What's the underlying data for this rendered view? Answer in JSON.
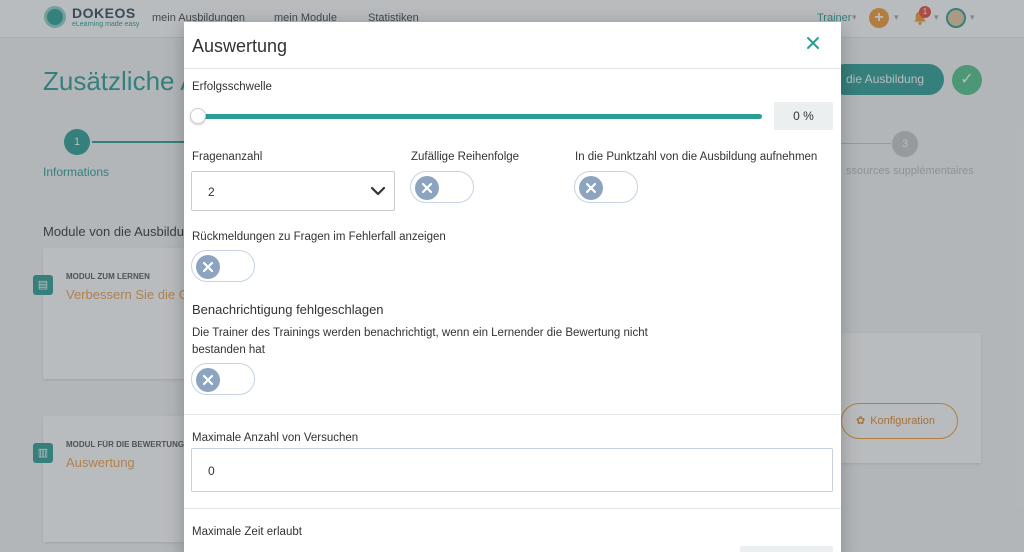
{
  "app": {
    "logo_name": "DOKEOS",
    "logo_tagline": "eLearning made easy",
    "nav": [
      "mein Ausbildungen",
      "mein Module",
      "Statistiken"
    ],
    "role": "Trainer",
    "notification_count": "1"
  },
  "page": {
    "title": "Zusätzliche A",
    "primary_button": "die Ausbildung",
    "steps": [
      {
        "number": "1",
        "label": "Informations"
      },
      {
        "number": "3",
        "label": "ssources supplémentaires"
      }
    ],
    "modules_heading": "Module von die Ausbildung",
    "cards": [
      {
        "kicker": "MODUL ZUM LERNEN",
        "title": "Verbessern Sie die G"
      },
      {
        "kicker": "MODUL FÜR DIE BEWERTUNG",
        "title": "Auswertung"
      }
    ],
    "config_button": "Konfiguration"
  },
  "modal": {
    "title": "Auswertung",
    "threshold_label": "Erfolgsschwelle",
    "threshold_value": "0 %",
    "threshold_fraction": 0,
    "question_count_label": "Fragenanzahl",
    "question_count_value": "2",
    "random_order_label": "Zufällige Reihenfolge",
    "random_order_on": false,
    "include_score_label": "In die Punktzahl von die Ausbildung aufnehmen",
    "include_score_on": false,
    "feedback_label": "Rückmeldungen zu Fragen im Fehlerfall anzeigen",
    "feedback_on": false,
    "failure_notification_title": "Benachrichtigung fehlgeschlagen",
    "failure_notification_desc": "Die Trainer des Trainings werden benachrichtigt, wenn ein Lernender die Bewertung nicht bestanden hat",
    "failure_notification_on": false,
    "max_attempts_label": "Maximale Anzahl von Versuchen",
    "max_attempts_value": "0",
    "max_time_label": "Maximale Zeit erlaubt"
  },
  "colors": {
    "accent": "#2a9d95",
    "orange": "#f39c34",
    "toggle_off_knob": "#8ca4bf"
  },
  "icons": [
    "logo-icon",
    "plus-icon",
    "bell-icon",
    "avatar",
    "check-icon",
    "book-icon",
    "chart-icon",
    "gear-icon",
    "close-icon",
    "chevron-down-icon",
    "x-icon"
  ]
}
